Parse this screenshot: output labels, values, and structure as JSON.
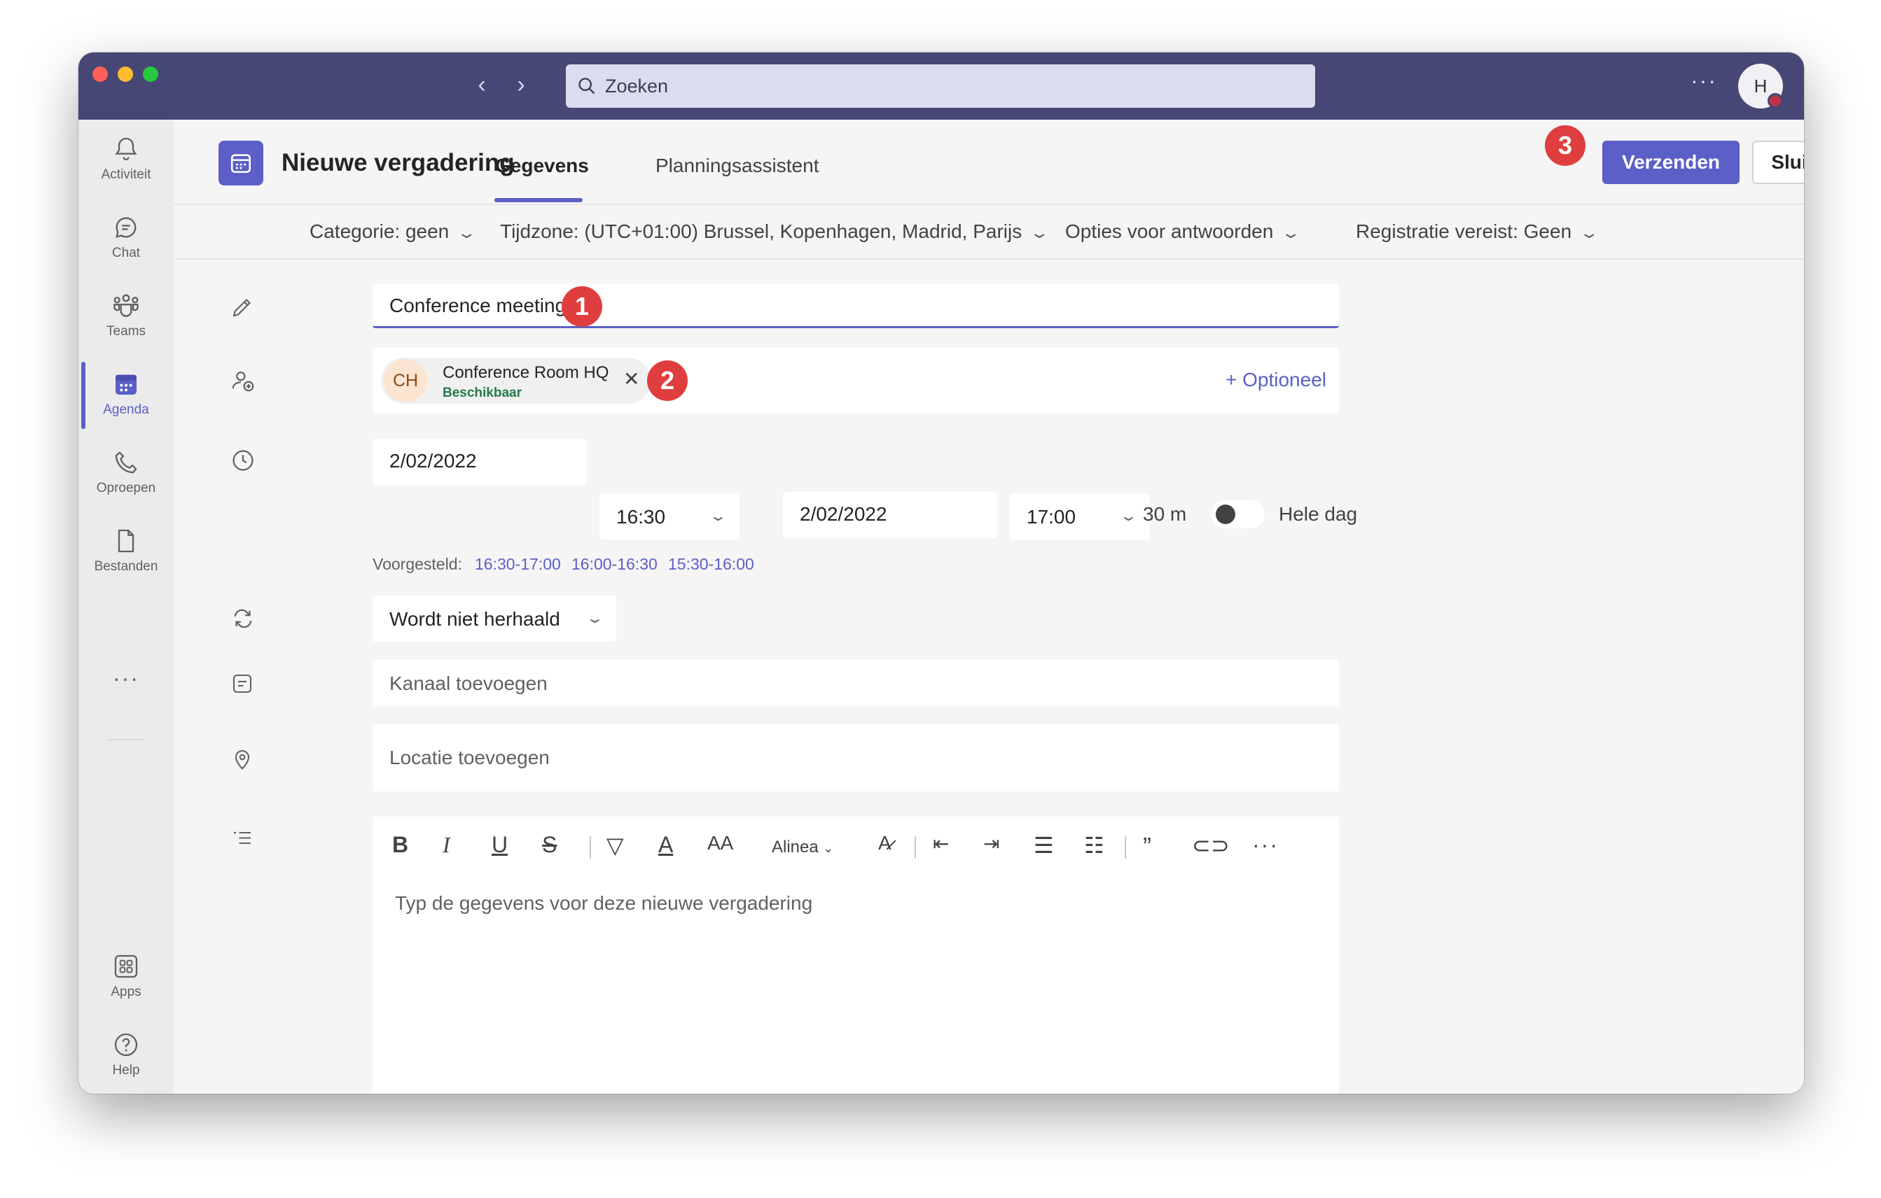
{
  "search": {
    "placeholder": "Zoeken"
  },
  "avatar": {
    "initial": "H"
  },
  "rail": {
    "items": [
      {
        "label": "Activiteit",
        "icon": "bell-icon"
      },
      {
        "label": "Chat",
        "icon": "chat-icon"
      },
      {
        "label": "Teams",
        "icon": "teams-icon"
      },
      {
        "label": "Agenda",
        "icon": "calendar-icon",
        "active": true
      },
      {
        "label": "Oproepen",
        "icon": "phone-icon"
      },
      {
        "label": "Bestanden",
        "icon": "file-icon"
      }
    ],
    "more": "···",
    "apps": "Apps",
    "help": "Help"
  },
  "header": {
    "title": "Nieuwe vergadering",
    "tabs": [
      "Gegevens",
      "Planningsassistent"
    ],
    "send": "Verzenden",
    "close": "Sluiten",
    "badge_send": "3"
  },
  "options": {
    "category": "Categorie: geen",
    "timezone": "Tijdzone: (UTC+01:00) Brussel, Kopenhagen, Madrid, Parijs",
    "reply": "Opties voor antwoorden",
    "registration": "Registratie vereist: Geen"
  },
  "form": {
    "title_value": "Conference meeting",
    "badge_title": "1",
    "attendee": {
      "initials": "CH",
      "name": "Conference Room HQ",
      "status": "Beschikbaar"
    },
    "badge_attendee": "2",
    "optional": "+ Optioneel",
    "start_date": "2/02/2022",
    "start_time": "16:30",
    "end_date": "2/02/2022",
    "end_time": "17:00",
    "duration": "30 m",
    "all_day": "Hele dag",
    "suggested_label": "Voorgesteld:",
    "suggested": [
      "16:30-17:00",
      "16:00-16:30",
      "15:30-16:00"
    ],
    "repeat": "Wordt niet herhaald",
    "channel_placeholder": "Kanaal toevoegen",
    "location_placeholder": "Locatie toevoegen",
    "paragraph": "Alinea",
    "editor_placeholder": "Typ de gegevens voor deze nieuwe vergadering"
  },
  "colors": {
    "accent": "#5b5fc7",
    "titlebar": "#464775",
    "badge": "#e03e3e"
  }
}
